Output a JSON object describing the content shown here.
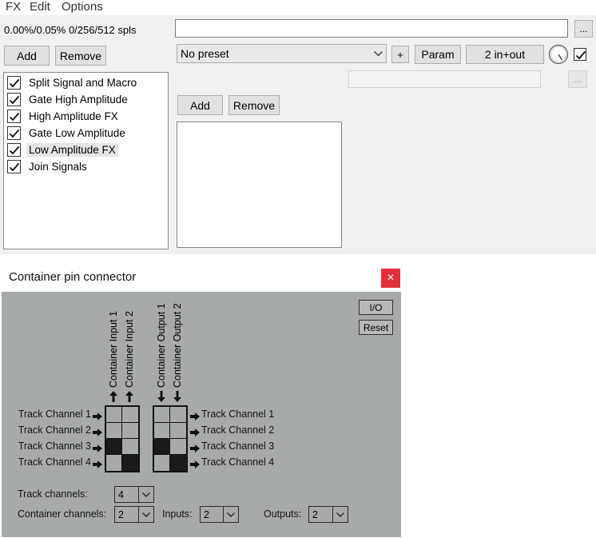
{
  "menu": {
    "fx": "FX",
    "edit": "Edit",
    "options": "Options"
  },
  "fx_window": {
    "cpu_stats": "0.00%/0.05% 0/256/512 spls",
    "add_label": "Add",
    "remove_label": "Remove",
    "fx_items": [
      {
        "label": "Split Signal and Macro",
        "enabled": true
      },
      {
        "label": "Gate High Amplitude",
        "enabled": true
      },
      {
        "label": "High Amplitude FX",
        "enabled": true
      },
      {
        "label": "Gate Low Amplitude",
        "enabled": true
      },
      {
        "label": "Low Amplitude FX",
        "enabled": true,
        "selected": true
      },
      {
        "label": "Join Signals",
        "enabled": true
      }
    ],
    "browse_label": "...",
    "preset_value": "No preset",
    "plus_label": "+",
    "param_label": "Param",
    "io_label": "2 in+out",
    "browse2_label": "...",
    "inner_add_label": "Add",
    "inner_remove_label": "Remove"
  },
  "pin_window": {
    "title": "Container pin connector",
    "close_label": "×",
    "io_button": "I/O",
    "reset_button": "Reset",
    "input_labels": [
      "Container Input 1",
      "Container Input 2"
    ],
    "output_labels": [
      "Container Output 1",
      "Container Output 2"
    ],
    "left_channels": [
      "Track Channel 1",
      "Track Channel 2",
      "Track Channel 3",
      "Track Channel 4"
    ],
    "right_channels": [
      "Track Channel 1",
      "Track Channel 2",
      "Track Channel 3",
      "Track Channel 4"
    ],
    "input_matrix": [
      [
        0,
        0
      ],
      [
        0,
        0
      ],
      [
        1,
        0
      ],
      [
        0,
        1
      ]
    ],
    "output_matrix": [
      [
        0,
        0
      ],
      [
        0,
        0
      ],
      [
        1,
        0
      ],
      [
        0,
        1
      ]
    ],
    "track_channels_label": "Track channels:",
    "track_channels_value": "4",
    "container_channels_label": "Container channels:",
    "container_channels_value": "2",
    "inputs_label": "Inputs:",
    "inputs_value": "2",
    "outputs_label": "Outputs:",
    "outputs_value": "2"
  },
  "icons": {
    "check": "check-icon",
    "dropdown": "chevron-down-icon",
    "arrow_right": "arrow-right-icon",
    "arrow_up": "arrow-up-icon",
    "arrow_down": "arrow-down-icon",
    "knob": "knob-icon",
    "close": "close-icon"
  },
  "colors": {
    "window_bg": "#f0f0f0",
    "pin_bg": "#a7aba8",
    "close_button": "#e0313a"
  }
}
